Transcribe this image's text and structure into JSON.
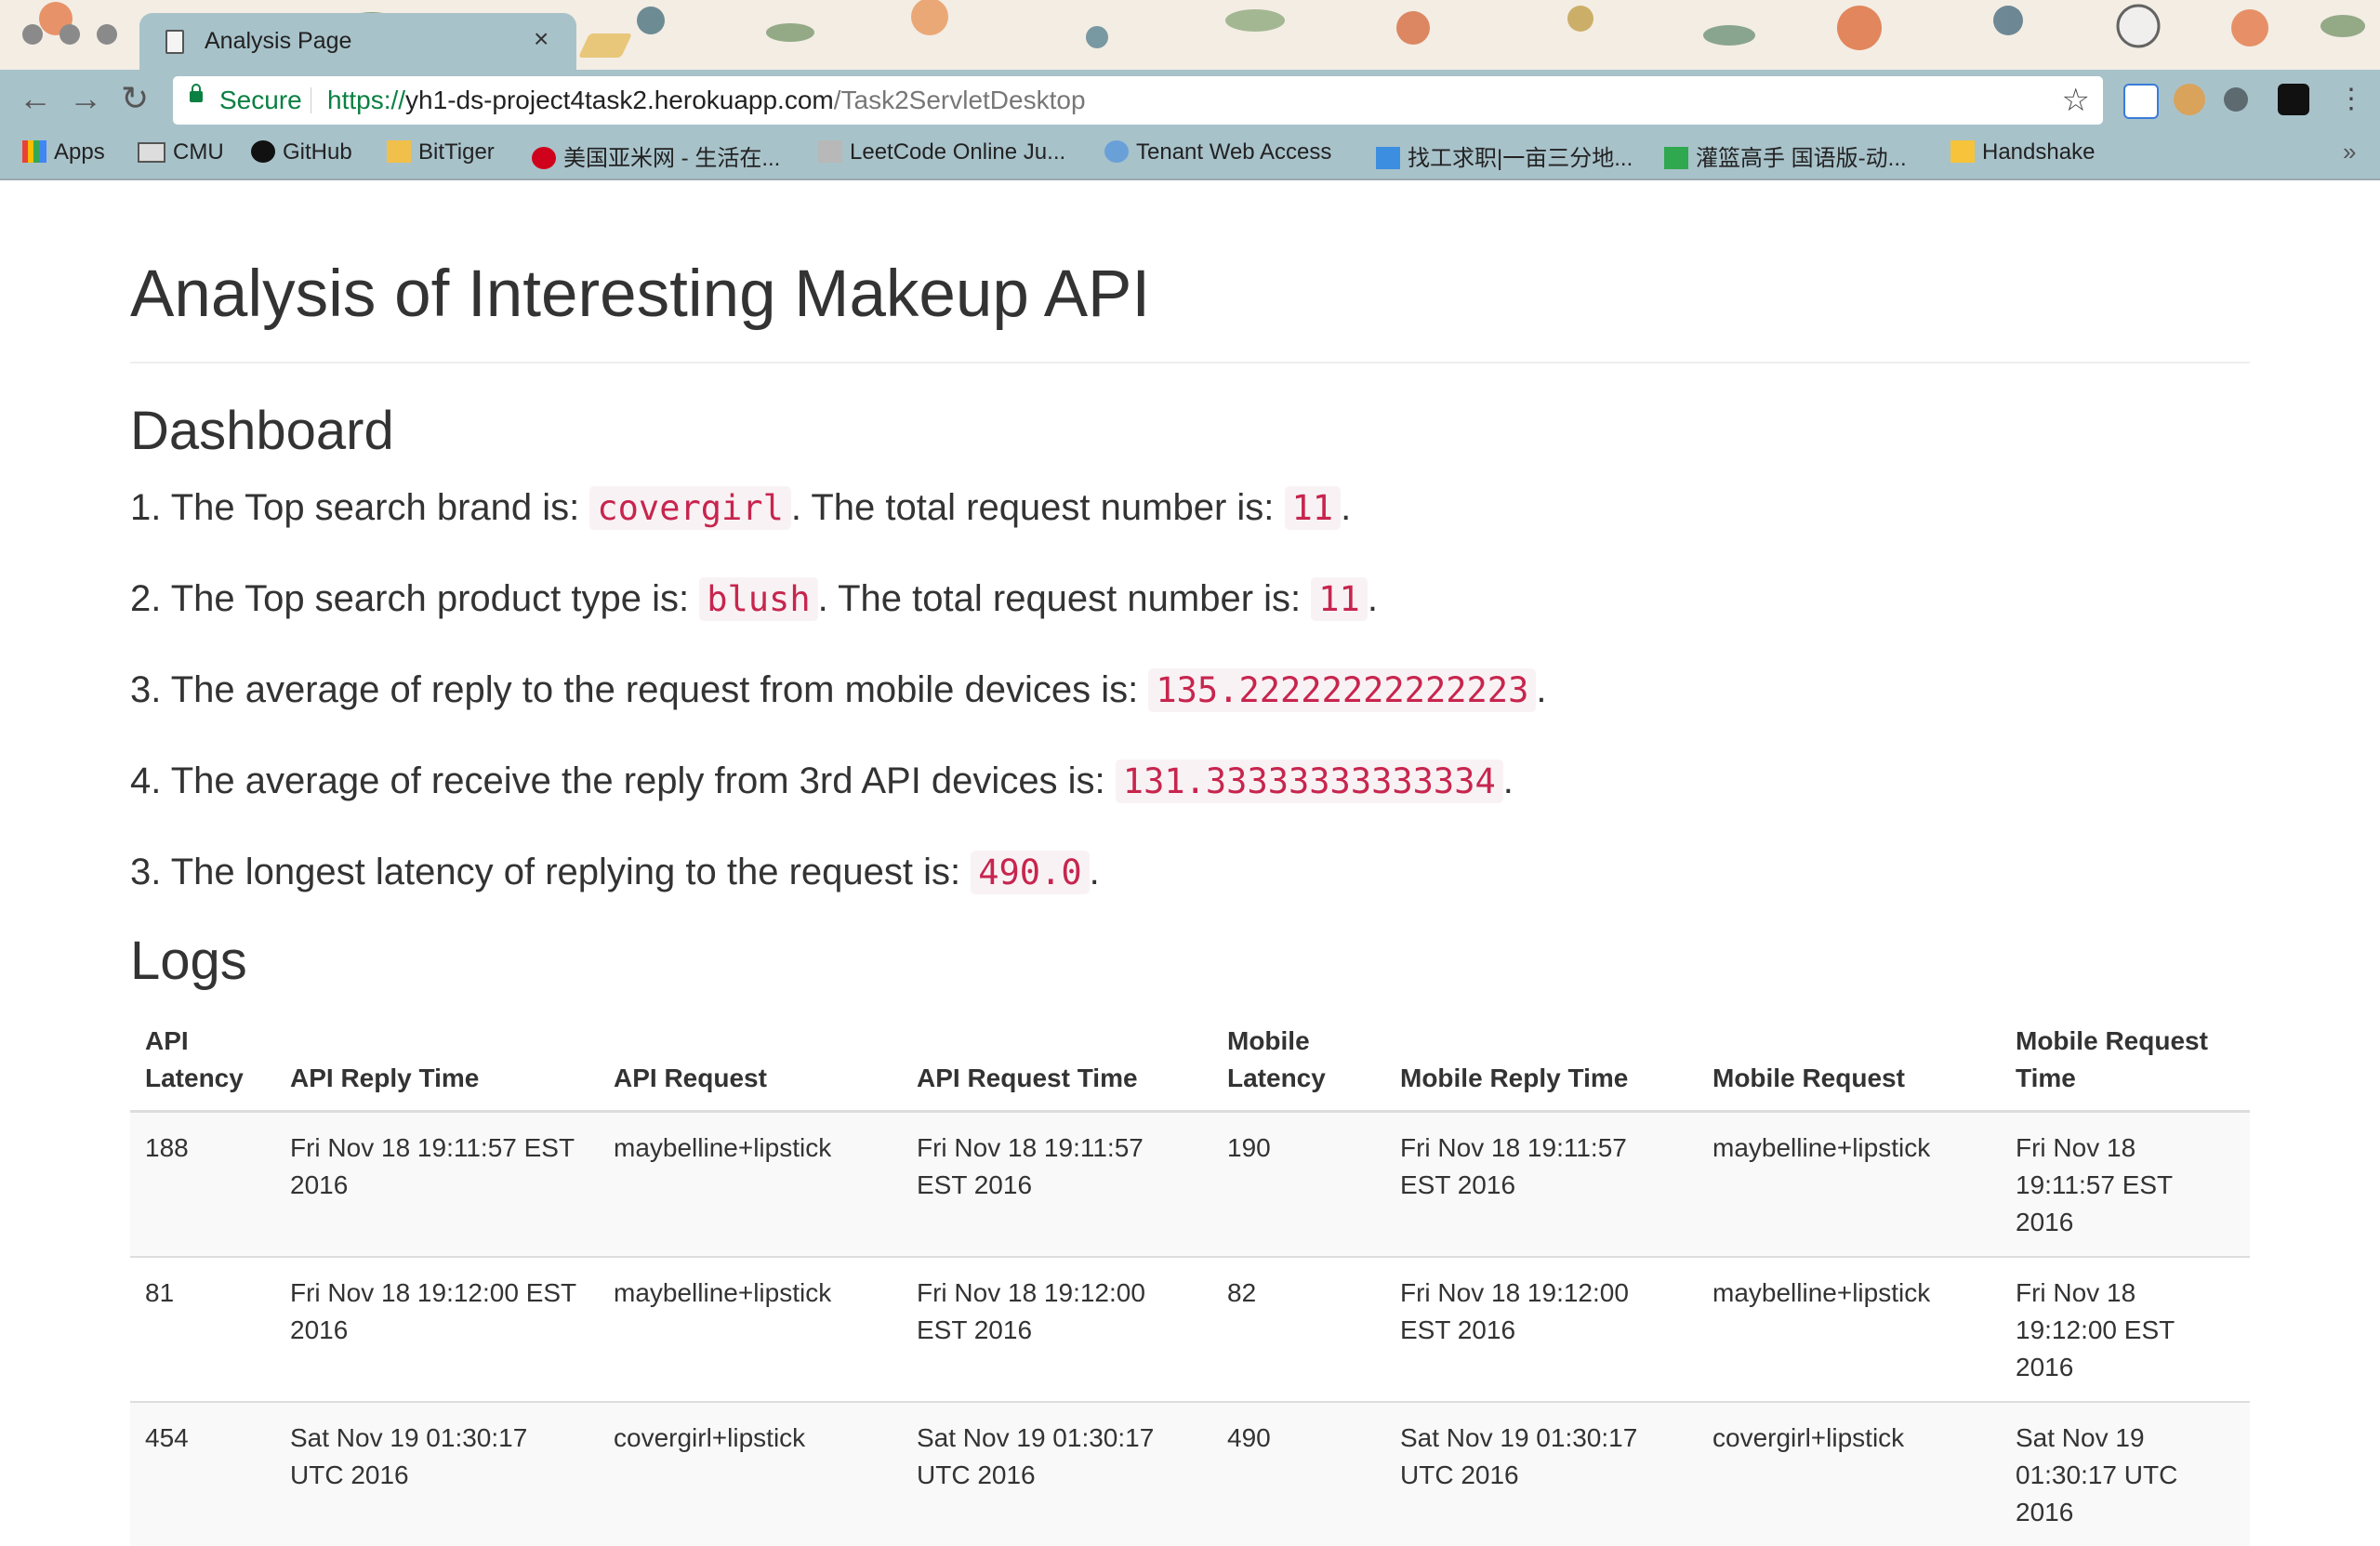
{
  "browser": {
    "tab_title": "Analysis Page",
    "tab_close": "×",
    "secure_label": "Secure",
    "url_scheme": "https://",
    "url_host": "yh1-ds-project4task2.herokuapp.com",
    "url_path": "/Task2ServletDesktop",
    "bookmarks": [
      "Apps",
      "CMU",
      "GitHub",
      "BitTiger",
      "美国亚米网 - 生活在...",
      "LeetCode Online Ju...",
      "Tenant Web Access",
      "找工求职|一亩三分地...",
      "灌篮高手 国语版-动...",
      "Handshake"
    ],
    "overflow": "»"
  },
  "page": {
    "title": "Analysis of Interesting Makeup API",
    "dashboard_heading": "Dashboard",
    "dashboard": [
      {
        "prefix": "1. The Top search brand is: ",
        "code1": "covergirl",
        "middle": ". The total request number is: ",
        "code2": "11",
        "suffix": "."
      },
      {
        "prefix": "2. The Top search product type is: ",
        "code1": "blush",
        "middle": ". The total request number is: ",
        "code2": "11",
        "suffix": "."
      },
      {
        "prefix": "3. The average of reply to the request from mobile devices is: ",
        "code1": "135.22222222222223",
        "suffix": "."
      },
      {
        "prefix": "4. The average of receive the reply from 3rd API devices is: ",
        "code1": "131.33333333333334",
        "suffix": "."
      },
      {
        "prefix": "3. The longest latency of replying to the request is: ",
        "code1": "490.0",
        "suffix": "."
      }
    ],
    "logs_heading": "Logs",
    "logs": {
      "headers": [
        "API Latency",
        "API Reply Time",
        "API Request",
        "API Request Time",
        "Mobile Latency",
        "Mobile Reply Time",
        "Mobile Request",
        "Mobile Request Time"
      ],
      "rows": [
        [
          "188",
          "Fri Nov 18 19:11:57 EST 2016",
          "maybelline+lipstick",
          "Fri Nov 18 19:11:57 EST 2016",
          "190",
          "Fri Nov 18 19:11:57 EST 2016",
          "maybelline+lipstick",
          "Fri Nov 18 19:11:57 EST 2016"
        ],
        [
          "81",
          "Fri Nov 18 19:12:00 EST 2016",
          "maybelline+lipstick",
          "Fri Nov 18 19:12:00 EST 2016",
          "82",
          "Fri Nov 18 19:12:00 EST 2016",
          "maybelline+lipstick",
          "Fri Nov 18 19:12:00 EST 2016"
        ],
        [
          "454",
          "Sat Nov 19 01:30:17 UTC 2016",
          "covergirl+lipstick",
          "Sat Nov 19 01:30:17 UTC 2016",
          "490",
          "Sat Nov 19 01:30:17 UTC 2016",
          "covergirl+lipstick",
          "Sat Nov 19 01:30:17 UTC 2016"
        ]
      ]
    }
  }
}
